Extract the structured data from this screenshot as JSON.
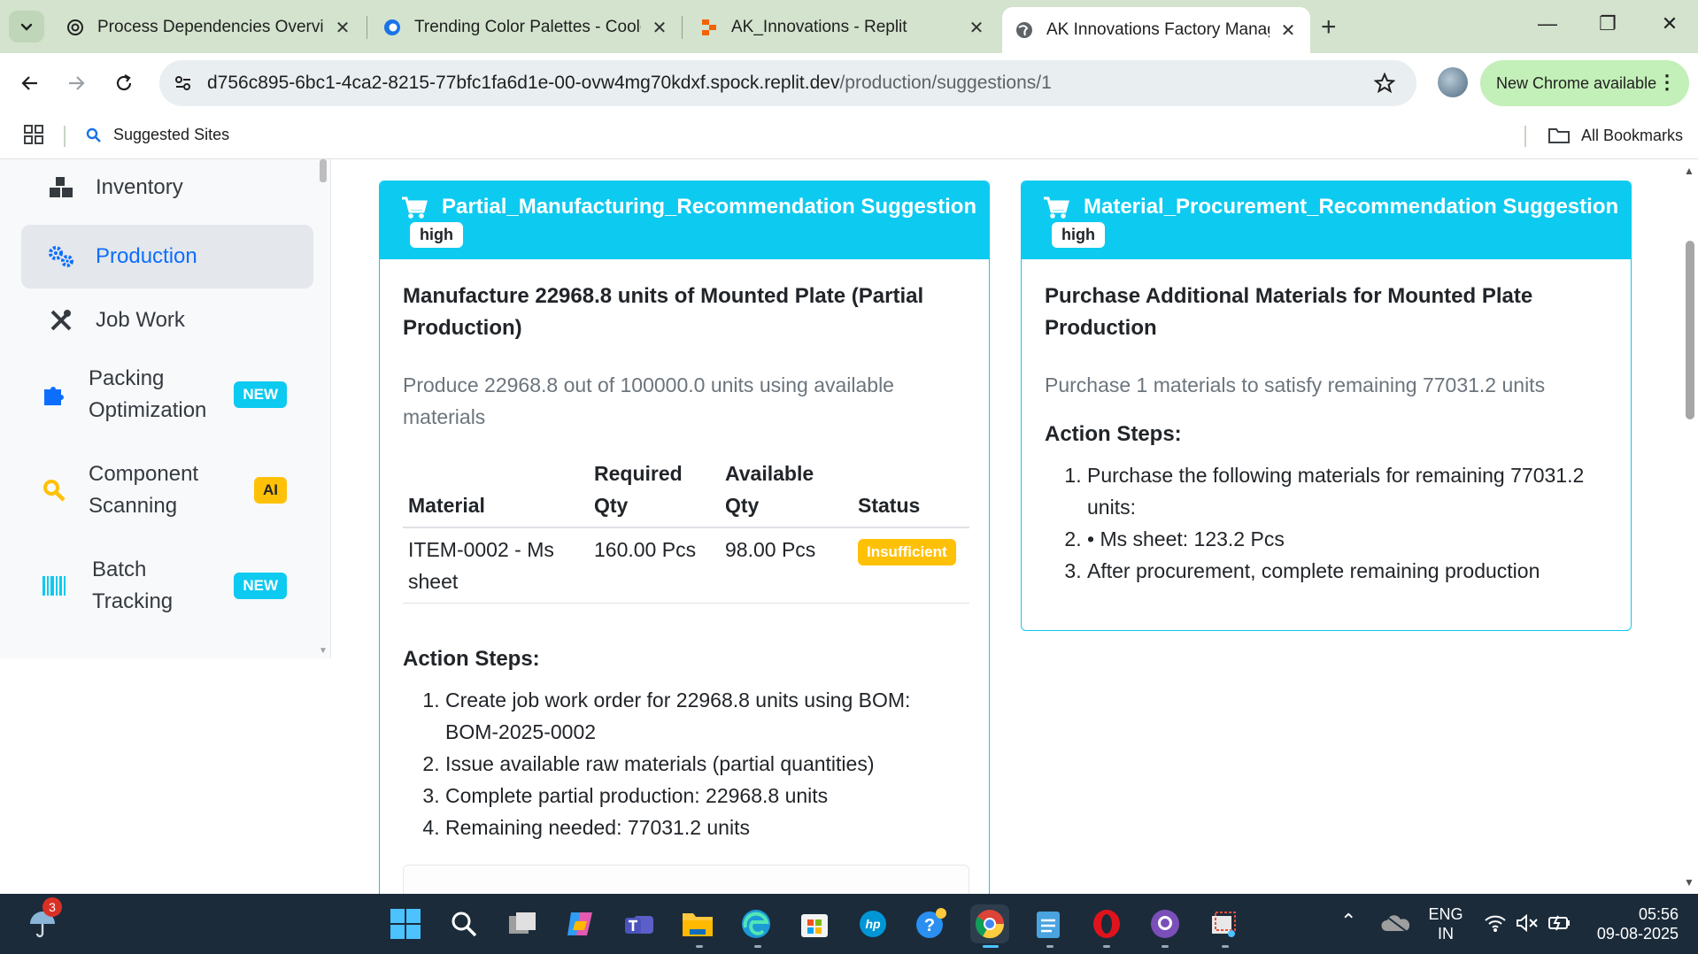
{
  "browser": {
    "tabs": [
      {
        "title": "Process Dependencies Overview",
        "icon": "openai-icon"
      },
      {
        "title": "Trending Color Palettes - Coolors",
        "icon": "coolors-icon"
      },
      {
        "title": "AK_Innovations - Replit",
        "icon": "replit-icon"
      },
      {
        "title": "AK Innovations Factory Management",
        "icon": "globe-icon",
        "active": true
      }
    ],
    "url_host": "d756c895-6bc1-4ca2-8215-77bfc1fa6d1e-00-ovw4mg70kdxf.spock.replit.dev",
    "url_path": "/production/suggestions/1",
    "update_label": "New Chrome available",
    "bookmarks": {
      "suggested_sites": "Suggested Sites",
      "all_bookmarks": "All Bookmarks"
    }
  },
  "sidebar": {
    "items": [
      {
        "label": "Inventory",
        "icon": "boxes-icon"
      },
      {
        "label": "Production",
        "icon": "gears-icon",
        "active": true
      },
      {
        "label": "Job Work",
        "icon": "tools-icon"
      },
      {
        "label_line1": "Packing",
        "label_line2": "Optimization",
        "badge": "NEW",
        "icon": "puzzle-icon"
      },
      {
        "label_line1": "Component",
        "label_line2": "Scanning",
        "badge": "AI",
        "icon": "search-icon"
      },
      {
        "label_line1": "Batch",
        "label_line2": "Tracking",
        "badge": "NEW",
        "icon": "barcode-icon"
      }
    ]
  },
  "cards": [
    {
      "header": "Partial_Manufacturing_Recommendation Suggestion",
      "priority": "high",
      "title": "Manufacture 22968.8 units of Mounted Plate (Partial Production)",
      "description": "Produce 22968.8 out of 100000.0 units using available materials",
      "table": {
        "headers": [
          "Material",
          "Required Qty",
          "Available Qty",
          "Status"
        ],
        "rows": [
          {
            "material": "ITEM-0002 - Ms sheet",
            "required": "160.00 Pcs",
            "available": "98.00 Pcs",
            "status": "Insufficient"
          }
        ]
      },
      "steps_title": "Action Steps:",
      "steps": [
        "Create job work order for 22968.8 units using BOM: BOM-2025-0002",
        "Issue available raw materials (partial quantities)",
        "Complete partial production: 22968.8 units",
        "Remaining needed: 77031.2 units"
      ]
    },
    {
      "header": "Material_Procurement_Recommendation Suggestion",
      "priority": "high",
      "title": "Purchase Additional Materials for Mounted Plate Production",
      "description": "Purchase 1 materials to satisfy remaining 77031.2 units",
      "steps_title": "Action Steps:",
      "steps": [
        "Purchase the following materials for remaining 77031.2 units:",
        "• Ms sheet: 123.2 Pcs",
        "After procurement, complete remaining production"
      ]
    }
  ],
  "taskbar": {
    "weather_badge": "3",
    "lang_line1": "ENG",
    "lang_line2": "IN",
    "time": "05:56",
    "date": "09-08-2025"
  },
  "colors": {
    "accent": "#0dcaf0",
    "primary": "#0d6efd",
    "warning": "#ffc107",
    "tabstrip": "#d3e3cd",
    "taskbar": "#1b2b3a"
  }
}
